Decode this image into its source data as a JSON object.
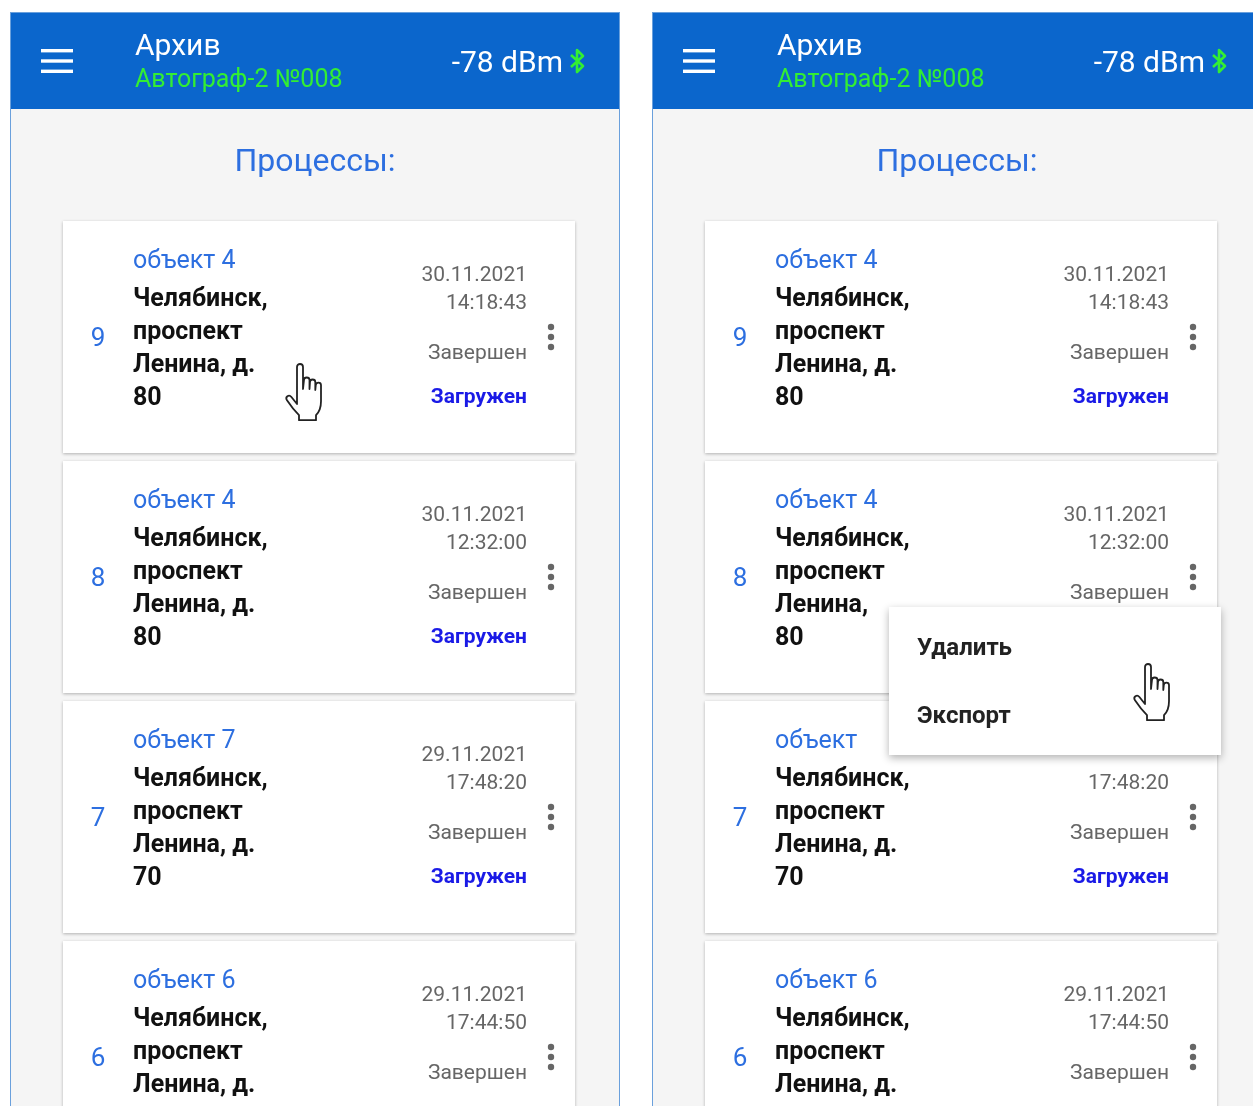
{
  "panels": [
    {
      "header": {
        "title": "Архив",
        "subtitle": "Автограф-2 №008",
        "signal": "-78 dBm"
      },
      "heading": "Процессы:",
      "cards": [
        {
          "number": "9",
          "title": "объект 4",
          "address_lines": [
            "Челябинск,",
            "проспект",
            "Ленина, д.",
            "80"
          ],
          "date": "30.11.2021",
          "time": "14:18:43",
          "status": "Завершен",
          "upload_status": "Загружен"
        },
        {
          "number": "8",
          "title": "объект 4",
          "address_lines": [
            "Челябинск,",
            "проспект",
            "Ленина, д.",
            "80"
          ],
          "date": "30.11.2021",
          "time": "12:32:00",
          "status": "Завершен",
          "upload_status": "Загружен"
        },
        {
          "number": "7",
          "title": "объект 7",
          "address_lines": [
            "Челябинск,",
            "проспект",
            "Ленина, д.",
            "70"
          ],
          "date": "29.11.2021",
          "time": "17:48:20",
          "status": "Завершен",
          "upload_status": "Загружен"
        },
        {
          "number": "6",
          "title": "объект 6",
          "address_lines": [
            "Челябинск,",
            "проспект",
            "Ленина, д."
          ],
          "date": "29.11.2021",
          "time": "17:44:50",
          "status": "Завершен"
        }
      ]
    },
    {
      "header": {
        "title": "Архив",
        "subtitle": "Автограф-2 №008",
        "signal": "-78 dBm"
      },
      "heading": "Процессы:",
      "menu": {
        "items": [
          {
            "label": "Удалить"
          },
          {
            "label": "Экспорт"
          }
        ]
      },
      "cards": [
        {
          "number": "9",
          "title": "объект 4",
          "address_lines": [
            "Челябинск,",
            "проспект",
            "Ленина, д.",
            "80"
          ],
          "date": "30.11.2021",
          "time": "14:18:43",
          "status": "Завершен",
          "upload_status": "Загружен"
        },
        {
          "number": "8",
          "title": "объект 4",
          "address_lines": [
            "Челябинск,",
            "проспект",
            "Ленина,",
            "80"
          ],
          "date": "30.11.2021",
          "time": "12:32:00",
          "status": "Завершен"
        },
        {
          "number": "7",
          "title": "объект",
          "address_lines": [
            "Челябинск,",
            "проспект",
            "Ленина, д.",
            "70"
          ],
          "time": "17:48:20",
          "status": "Завершен",
          "upload_status": "Загружен"
        },
        {
          "number": "6",
          "title": "объект 6",
          "address_lines": [
            "Челябинск,",
            "проспект",
            "Ленина, д."
          ],
          "date": "29.11.2021",
          "time": "17:44:50",
          "status": "Завершен"
        }
      ]
    }
  ]
}
